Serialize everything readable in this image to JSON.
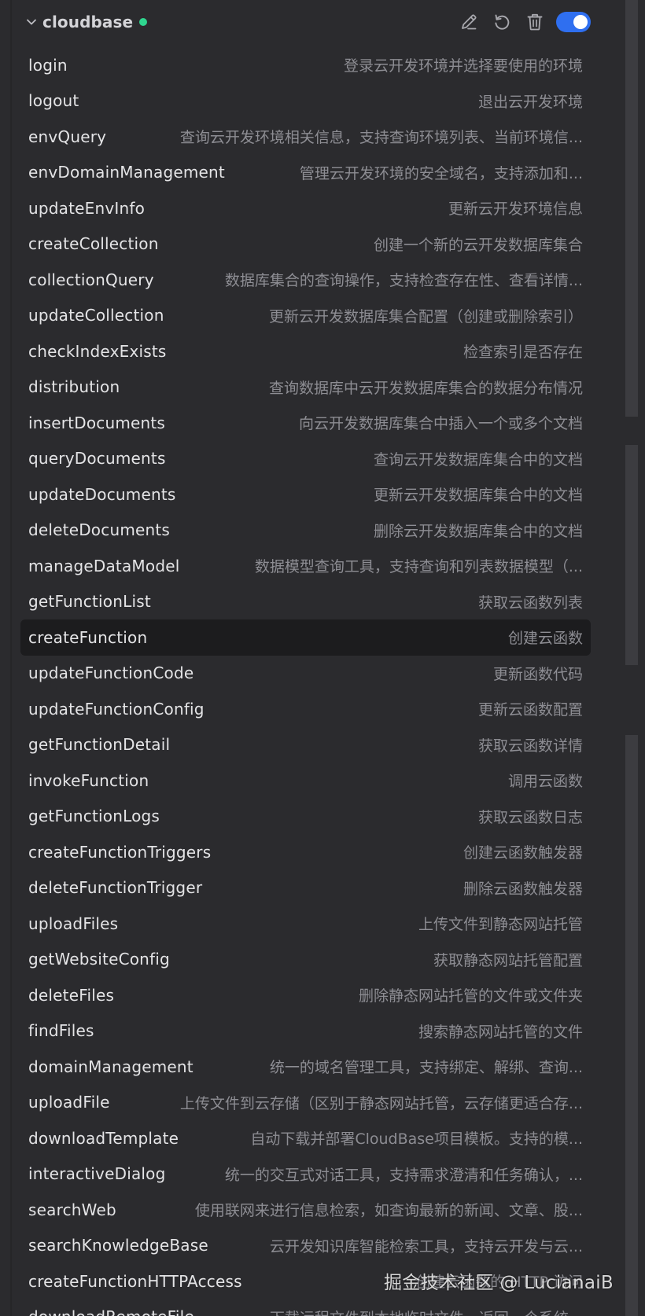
{
  "server": {
    "name": "cloudbase",
    "status_color": "#2fd68f",
    "enabled": true,
    "toggle_color": "#2f6ff0"
  },
  "header_icons": [
    "edit-icon",
    "refresh-icon",
    "trash-icon"
  ],
  "tools": [
    {
      "name": "login",
      "desc": "登录云开发环境并选择要使用的环境"
    },
    {
      "name": "logout",
      "desc": "退出云开发环境"
    },
    {
      "name": "envQuery",
      "desc": "查询云开发环境相关信息，支持查询环境列表、当前环境信..."
    },
    {
      "name": "envDomainManagement",
      "desc": "管理云开发环境的安全域名，支持添加和..."
    },
    {
      "name": "updateEnvInfo",
      "desc": "更新云开发环境信息"
    },
    {
      "name": "createCollection",
      "desc": "创建一个新的云开发数据库集合"
    },
    {
      "name": "collectionQuery",
      "desc": "数据库集合的查询操作，支持检查存在性、查看详情..."
    },
    {
      "name": "updateCollection",
      "desc": "更新云开发数据库集合配置（创建或删除索引）"
    },
    {
      "name": "checkIndexExists",
      "desc": "检查索引是否存在"
    },
    {
      "name": "distribution",
      "desc": "查询数据库中云开发数据库集合的数据分布情况"
    },
    {
      "name": "insertDocuments",
      "desc": "向云开发数据库集合中插入一个或多个文档"
    },
    {
      "name": "queryDocuments",
      "desc": "查询云开发数据库集合中的文档"
    },
    {
      "name": "updateDocuments",
      "desc": "更新云开发数据库集合中的文档"
    },
    {
      "name": "deleteDocuments",
      "desc": "删除云开发数据库集合中的文档"
    },
    {
      "name": "manageDataModel",
      "desc": "数据模型查询工具，支持查询和列表数据模型（..."
    },
    {
      "name": "getFunctionList",
      "desc": "获取云函数列表"
    },
    {
      "name": "createFunction",
      "desc": "创建云函数",
      "highlighted": true
    },
    {
      "name": "updateFunctionCode",
      "desc": "更新函数代码"
    },
    {
      "name": "updateFunctionConfig",
      "desc": "更新云函数配置"
    },
    {
      "name": "getFunctionDetail",
      "desc": "获取云函数详情"
    },
    {
      "name": "invokeFunction",
      "desc": "调用云函数"
    },
    {
      "name": "getFunctionLogs",
      "desc": "获取云函数日志"
    },
    {
      "name": "createFunctionTriggers",
      "desc": "创建云函数触发器"
    },
    {
      "name": "deleteFunctionTrigger",
      "desc": "删除云函数触发器"
    },
    {
      "name": "uploadFiles",
      "desc": "上传文件到静态网站托管"
    },
    {
      "name": "getWebsiteConfig",
      "desc": "获取静态网站托管配置"
    },
    {
      "name": "deleteFiles",
      "desc": "删除静态网站托管的文件或文件夹"
    },
    {
      "name": "findFiles",
      "desc": "搜索静态网站托管的文件"
    },
    {
      "name": "domainManagement",
      "desc": "统一的域名管理工具，支持绑定、解绑、查询..."
    },
    {
      "name": "uploadFile",
      "desc": "上传文件到云存储（区别于静态网站托管，云存储更适合存..."
    },
    {
      "name": "downloadTemplate",
      "desc": "自动下载并部署CloudBase项目模板。支持的模..."
    },
    {
      "name": "interactiveDialog",
      "desc": "统一的交互式对话工具，支持需求澄清和任务确认，..."
    },
    {
      "name": "searchWeb",
      "desc": "使用联网来进行信息检索，如查询最新的新闻、文章、股..."
    },
    {
      "name": "searchKnowledgeBase",
      "desc": "云开发知识库智能检索工具，支持云开发与云..."
    },
    {
      "name": "createFunctionHTTPAccess",
      "desc": "创建云函数的 HTTP 访问"
    },
    {
      "name": "downloadRemoteFile",
      "desc": "下载远程文件到本地临时文件，返回一个系统..."
    }
  ],
  "watermark": "掘金技术社区 @ LucianaiB"
}
